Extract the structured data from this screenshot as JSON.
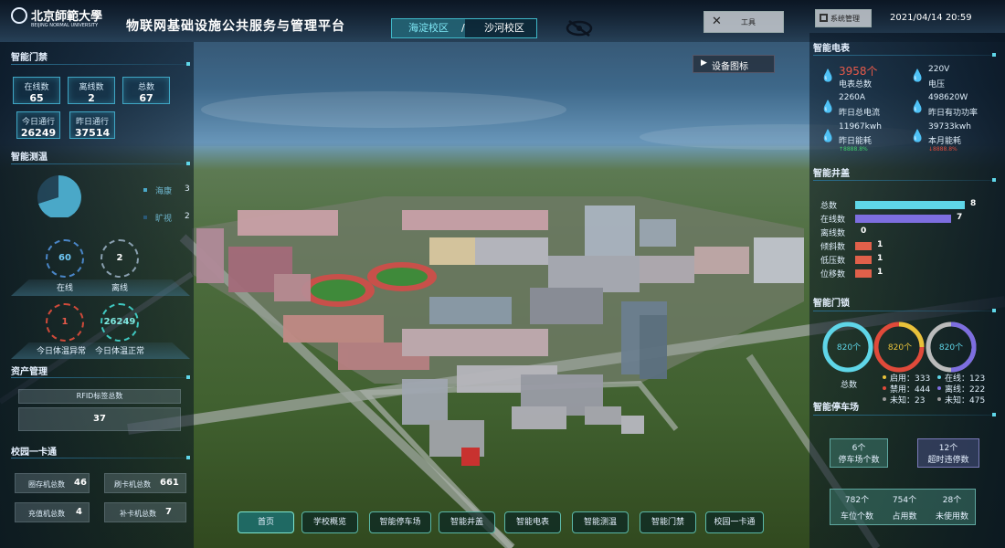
{
  "header": {
    "logo_text": "北京師範大學",
    "logo_sub": "BEIJING NORMAL UNIVERSITY",
    "app_title": "物联网基础设施公共服务与管理平台",
    "campus_tabs": [
      "海淀校区",
      "沙河校区"
    ],
    "campus_sep": "/",
    "tools_label": "工具",
    "system_label": "系统管理",
    "datetime": "2021/04/14 20:59",
    "device_icons_label": "设备图标"
  },
  "access": {
    "title": "智能门禁",
    "online_label": "在线数",
    "online": "65",
    "offline_label": "离线数",
    "offline": "2",
    "total_label": "总数",
    "total": "67",
    "today_label": "今日通行",
    "today": "26249",
    "yesterday_label": "昨日通行",
    "yesterday": "37514"
  },
  "temp": {
    "title": "智能测温",
    "legend": [
      {
        "name": "海康",
        "value": "3"
      },
      {
        "name": "旷视",
        "value": "2"
      }
    ],
    "online": "60",
    "offline": "2",
    "online_label": "在线",
    "offline_label": "离线",
    "abnormal": "1",
    "normal": "26249",
    "abnormal_label": "今日体温异常",
    "normal_label": "今日体温正常"
  },
  "asset": {
    "title": "资产管理",
    "rfid_label": "RFID标签总数",
    "rfid_value": "37"
  },
  "card": {
    "title": "校园一卡通",
    "items": [
      {
        "label": "圈存机总数",
        "value": "46"
      },
      {
        "label": "刷卡机总数",
        "value": "661"
      },
      {
        "label": "充值机总数",
        "value": "4"
      },
      {
        "label": "补卡机总数",
        "value": "7"
      }
    ]
  },
  "meter": {
    "title": "智能电表",
    "cells": [
      {
        "value": "3958个",
        "label": "电表总数"
      },
      {
        "value": "220V",
        "label": "电压"
      },
      {
        "value": "2260A",
        "label": "昨日总电流"
      },
      {
        "value": "498620W",
        "label": "昨日有功功率"
      },
      {
        "value": "11967kwh",
        "label": "昨日能耗"
      },
      {
        "value": "39733kwh",
        "label": "本月能耗"
      }
    ],
    "yesterday_change": "↑8888.8%",
    "month_change": "↓8888.8%"
  },
  "manhole": {
    "title": "智能井盖",
    "rows": [
      {
        "label": "总数",
        "value": "8"
      },
      {
        "label": "在线数",
        "value": "7"
      },
      {
        "label": "离线数",
        "value": "0"
      },
      {
        "label": "倾斜数",
        "value": "1"
      },
      {
        "label": "低压数",
        "value": "1"
      },
      {
        "label": "位移数",
        "value": "1"
      }
    ],
    "max": 8,
    "colors": [
      "#5fd6e8",
      "#7d6ee0",
      "#4a9fc0",
      "#e0604a",
      "#e0604a",
      "#e0604a"
    ]
  },
  "lock": {
    "title": "智能门锁",
    "rings": [
      "820个",
      "820个",
      "820个"
    ],
    "total_label": "总数",
    "stats": [
      {
        "label": "启用：333",
        "color": "#e8c23a"
      },
      {
        "label": "在线：123",
        "color": "#5fd6e8"
      },
      {
        "label": "禁用：444",
        "color": "#e04a3a"
      },
      {
        "label": "离线：222",
        "color": "#7d6ee0"
      },
      {
        "label": "未知：23",
        "color": "#999999"
      },
      {
        "label": "未知：475",
        "color": "#999999"
      }
    ]
  },
  "parking": {
    "title": "智能停车场",
    "lots": {
      "value": "6个",
      "label": "停车场个数"
    },
    "overtime": {
      "value": "12个",
      "label": "超时违停数"
    },
    "spaces": [
      {
        "value": "782个",
        "label": "车位个数"
      },
      {
        "value": "754个",
        "label": "占用数"
      },
      {
        "value": "28个",
        "label": "未使用数"
      }
    ]
  },
  "nav": [
    "首页",
    "学校概览",
    "智能停车场",
    "智能井盖",
    "智能电表",
    "智能测温",
    "智能门禁",
    "校园一卡通"
  ]
}
